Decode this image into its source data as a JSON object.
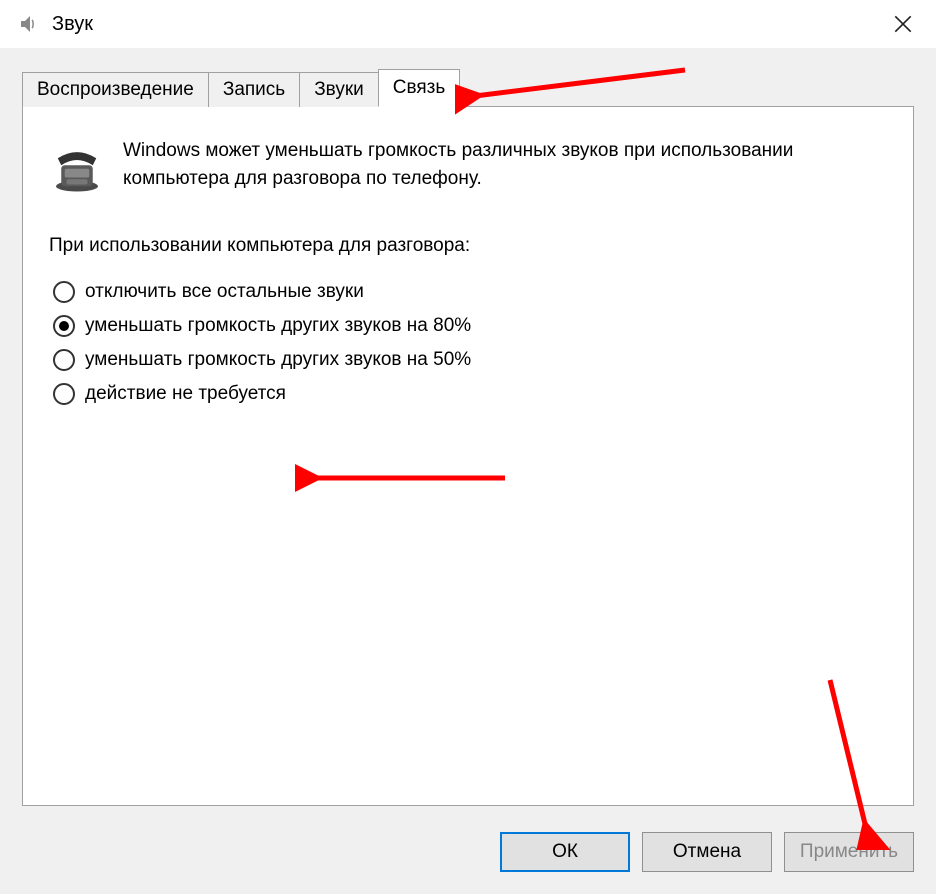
{
  "window": {
    "title": "Звук"
  },
  "tabs": [
    {
      "label": "Воспроизведение"
    },
    {
      "label": "Запись"
    },
    {
      "label": "Звуки"
    },
    {
      "label": "Связь"
    }
  ],
  "activeTab": 3,
  "content": {
    "info": "Windows может уменьшать громкость различных звуков при использовании компьютера для разговора по телефону.",
    "sectionLabel": "При использовании компьютера для разговора:",
    "options": [
      {
        "label": "отключить все остальные звуки",
        "checked": false
      },
      {
        "label": "уменьшать громкость других звуков на 80%",
        "checked": true
      },
      {
        "label": "уменьшать громкость других звуков на 50%",
        "checked": false
      },
      {
        "label": "действие не требуется",
        "checked": false
      }
    ]
  },
  "buttons": {
    "ok": "ОК",
    "cancel": "Отмена",
    "apply": "Применить"
  }
}
